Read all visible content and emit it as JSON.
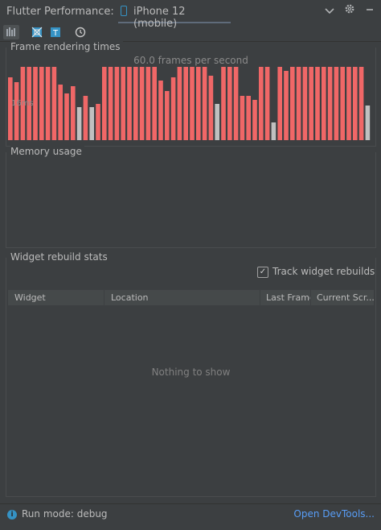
{
  "header": {
    "title": "Flutter Performance:",
    "device": "iPhone 12 (mobile)"
  },
  "toolbar": {
    "tools": [
      "performance-overlay",
      "debug-paint",
      "text-baselines",
      "slow-animations"
    ]
  },
  "frames": {
    "title": "Frame rendering times",
    "fps_label": "60.0 frames per second",
    "budget_label": "16ms",
    "bar_color": "#f06767",
    "slow_color": "#c0c0c0",
    "bars": [
      0.84,
      0.77,
      0.98,
      0.98,
      0.98,
      0.98,
      0.98,
      0.98,
      0.74,
      0.62,
      0.72,
      0.44,
      0.59,
      0.44,
      0.48,
      0.98,
      0.98,
      0.98,
      0.98,
      0.98,
      0.98,
      0.98,
      0.98,
      0.98,
      0.8,
      0.66,
      0.84,
      0.98,
      0.98,
      0.98,
      0.98,
      0.98,
      0.86,
      0.48,
      0.98,
      0.98,
      0.98,
      0.59,
      0.59,
      0.54,
      0.98,
      0.98,
      0.24,
      0.98,
      0.93,
      0.98,
      0.98,
      0.98,
      0.98,
      0.98,
      0.98,
      0.98,
      0.98,
      0.98,
      0.98,
      0.98,
      0.98,
      0.46
    ],
    "slow_indices": [
      11,
      13,
      33,
      42,
      57
    ]
  },
  "memory": {
    "title": "Memory usage"
  },
  "rebuild": {
    "title": "Widget rebuild stats",
    "track_label": "Track widget rebuilds",
    "track_checked": true,
    "columns": [
      "Widget",
      "Location",
      "Last Frame",
      "Current Scr..."
    ],
    "empty_text": "Nothing to show"
  },
  "status": {
    "run_mode": "Run mode: debug",
    "devtools_link": "Open DevTools..."
  },
  "colors": {
    "accent": "#3592c4",
    "link": "#589df6"
  }
}
